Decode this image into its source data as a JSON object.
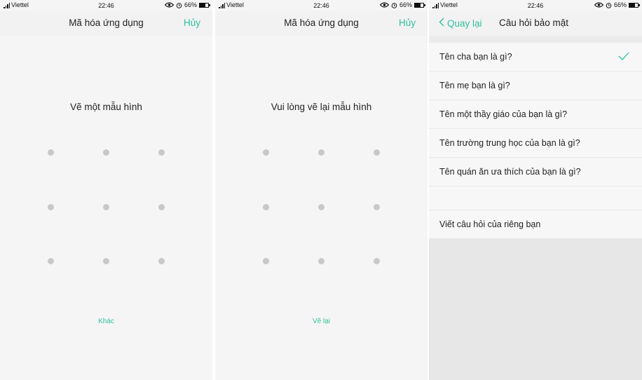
{
  "status": {
    "carrier": "Viettel",
    "time": "22:46",
    "battery": "66%",
    "battery_level": 0.66
  },
  "screens": [
    {
      "title": "Mã hóa ứng dụng",
      "action": "Hủy",
      "prompt": "Vẽ một mẫu hình",
      "footer": "Khác"
    },
    {
      "title": "Mã hóa ứng dụng",
      "action": "Hủy",
      "prompt": "Vui lòng vẽ lại mẫu hình",
      "footer": "Vẽ lại"
    },
    {
      "back_label": "Quay lại",
      "title": "Câu hỏi bảo mật",
      "questions": [
        {
          "label": "Tên cha bạn là gì?",
          "selected": true
        },
        {
          "label": "Tên mẹ bạn là gì?",
          "selected": false
        },
        {
          "label": "Tên một thầy giáo của bạn là gì?",
          "selected": false
        },
        {
          "label": "Tên trường trung học của bạn là gì?",
          "selected": false
        },
        {
          "label": "Tên quán ăn ưa thích của bạn là gì?",
          "selected": false
        }
      ],
      "custom_question": "Viết câu hỏi của riêng bạn"
    }
  ],
  "colors": {
    "accent": "#2fbf9f",
    "dot": "#c8c8c8",
    "background": "#f5f5f5"
  },
  "icons": [
    "signal-icon",
    "eye-icon",
    "alarm-icon",
    "battery-icon",
    "chevron-left-icon",
    "check-icon"
  ]
}
